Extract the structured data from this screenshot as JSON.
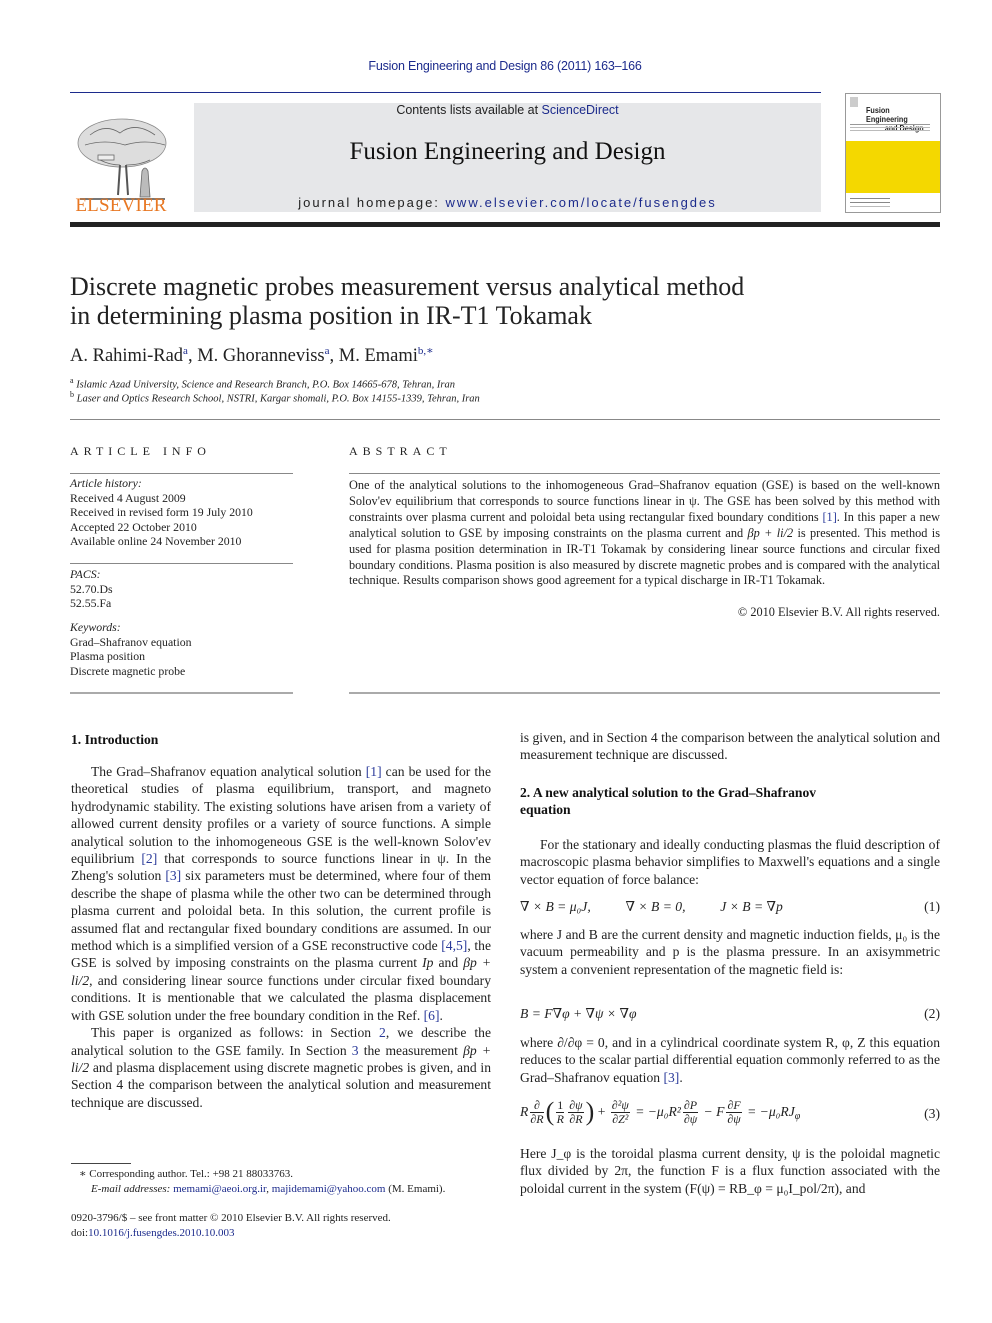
{
  "header": {
    "citation": "Fusion Engineering and Design 86 (2011) 163–166",
    "contents_prefix": "Contents lists available at ",
    "contents_link": "ScienceDirect",
    "journal_name": "Fusion Engineering and Design",
    "homepage_prefix": "journal homepage: ",
    "homepage_link": "www.elsevier.com/locate/fusengdes",
    "publisher_logo_text": "ELSEVIER",
    "cover_title_line1": "Fusion Engineering",
    "cover_title_line2": "and Design",
    "colors": {
      "brand_orange": "#e87722",
      "link_blue": "#1c2b8c",
      "banner_gray": "#e6e7e9",
      "cover_yellow": "#f4d800"
    }
  },
  "article": {
    "title_line1": "Discrete magnetic probes measurement versus analytical method",
    "title_line2": "in determining plasma position in IR-T1 Tokamak",
    "authors": [
      {
        "name": "A. Rahimi-Rad",
        "sup": "a"
      },
      {
        "name": "M. Ghoranneviss",
        "sup": "a"
      },
      {
        "name": "M. Emami",
        "sup": "b,∗"
      }
    ],
    "affiliations": [
      {
        "mark": "a",
        "text": "Islamic Azad University, Science and Research Branch, P.O. Box 14665-678, Tehran, Iran"
      },
      {
        "mark": "b",
        "text": "Laser and Optics Research School, NSTRI, Kargar shomali, P.O. Box 14155-1339, Tehran, Iran"
      }
    ]
  },
  "article_info": {
    "heading": "ARTICLE INFO",
    "history_label": "Article history:",
    "history": [
      "Received 4 August 2009",
      "Received in revised form 19 July 2010",
      "Accepted 22 October 2010",
      "Available online 24 November 2010"
    ],
    "pacs_label": "PACS:",
    "pacs": [
      "52.70.Ds",
      "52.55.Fa"
    ],
    "keywords_label": "Keywords:",
    "keywords": [
      "Grad–Shafranov equation",
      "Plasma position",
      "Discrete magnetic probe"
    ]
  },
  "abstract": {
    "heading": "ABSTRACT",
    "part1": "One of the analytical solutions to the inhomogeneous Grad–Shafranov equation (GSE) is based on the well-known Solov'ev equilibrium that corresponds to source functions linear in ψ. The GSE has been solved by this method with constraints over plasma current and poloidal beta using rectangular fixed boundary conditions ",
    "ref1": "[1]",
    "part2": ". In this paper a new analytical solution to GSE by imposing constraints on the plasma current and ",
    "math": "βp + li/2",
    "part3": " is presented. This method is used for plasma position determination in IR-T1 Tokamak by considering linear source functions and circular fixed boundary conditions. Plasma position is also measured by discrete magnetic probes and is compared with the analytical technique. Results comparison shows good agreement for a typical discharge in IR-T1 Tokamak.",
    "copyright": "© 2010 Elsevier B.V. All rights reserved."
  },
  "section1": {
    "heading": "1.  Introduction",
    "p1_a": "The Grad–Shafranov equation analytical solution ",
    "p1_ref1": "[1]",
    "p1_b": " can be used for the theoretical studies of plasma equilibrium, transport, and magneto hydrodynamic stability. The existing solutions have arisen from a variety of allowed current density profiles or a variety of source functions. A simple analytical solution to the inhomogeneous GSE is the well-known Solov'ev equilibrium ",
    "p1_ref2": "[2]",
    "p1_c": " that corresponds to source functions linear in ψ. In the Zheng's solution ",
    "p1_ref3": "[3]",
    "p1_d": " six parameters must be determined, where four of them describe the shape of plasma while the other two can be determined through plasma current and poloidal beta. In this solution, the current profile is assumed flat and rectangular fixed boundary conditions are assumed. In our method which is a simplified version of a GSE reconstructive code ",
    "p1_ref4": "[4,5]",
    "p1_e": ", the GSE is solved by imposing constraints on the plasma current ",
    "p1_math1": "Ip",
    "p1_f": " and ",
    "p1_math2": "βp + li/2",
    "p1_g": ", and considering linear source functions under circular fixed boundary conditions. It is mentionable that we calculated the plasma displacement with GSE solution under the free boundary condition in the Ref. ",
    "p1_ref6": "[6]",
    "p1_h": ".",
    "p2_a": "This paper is organized as follows: in Section ",
    "p2_ref2": "2",
    "p2_b": ", we describe the analytical solution to the GSE family. In Section ",
    "p2_ref3": "3",
    "p2_c": " the measurement ",
    "p2_math": "βp + li/2",
    "p2_d": " and plasma displacement using discrete magnetic probes is given, and in Section 4 the comparison between the analytical solution and measurement technique are discussed."
  },
  "section2": {
    "heading_line1": "2.  A new analytical solution to the Grad–Shafranov",
    "heading_line2": "equation",
    "p1": "For the stationary and ideally conducting plasmas the fluid description of macroscopic plasma behavior simplifies to Maxwell's equations and a single vector equation of force balance:",
    "eq1": {
      "a": "∇ × B = μ₀J,",
      "b": "∇ × B = 0,",
      "c": "J × B = ∇p",
      "num": "(1)"
    },
    "p2": "where J and B are the current density and magnetic induction fields, μ₀ is the vacuum permeability and p is the plasma pressure. In an axisymmetric system a convenient representation of the magnetic field is:",
    "eq2": {
      "expr": "B = F∇φ + ∇ψ × ∇φ",
      "num": "(2)"
    },
    "p3_a": "where ∂/∂φ = 0, and in a cylindrical coordinate system R, φ, Z this equation reduces to the scalar partial differential equation commonly referred to as the Grad–Shafranov equation ",
    "p3_ref": "[3]",
    "p3_b": ".",
    "eq3": {
      "num": "(3)",
      "rhs1": "= −μ₀R²",
      "mid": "− F",
      "rhs2": "= −μ₀RJ",
      "sub": "φ"
    },
    "p4": "Here J_φ is the toroidal plasma current density, ψ is the poloidal magnetic flux divided by 2π, the function F is a flux function associated with the poloidal current in the system (F(ψ) = RB_φ = μ₀I_pol/2π), and"
  },
  "footnote": {
    "corresponding": "∗  Corresponding author. Tel.: +98 21 88033763.",
    "email_label": "E-mail addresses: ",
    "email1": "memami@aeoi.org.ir",
    "sep": ", ",
    "email2": "majidemami@yahoo.com",
    "email_owner": " (M. Emami)."
  },
  "front_matter": {
    "issn_line": "0920-3796/$ – see front matter © 2010 Elsevier B.V. All rights reserved.",
    "doi_prefix": "doi:",
    "doi": "10.1016/j.fusengdes.2010.10.003"
  }
}
